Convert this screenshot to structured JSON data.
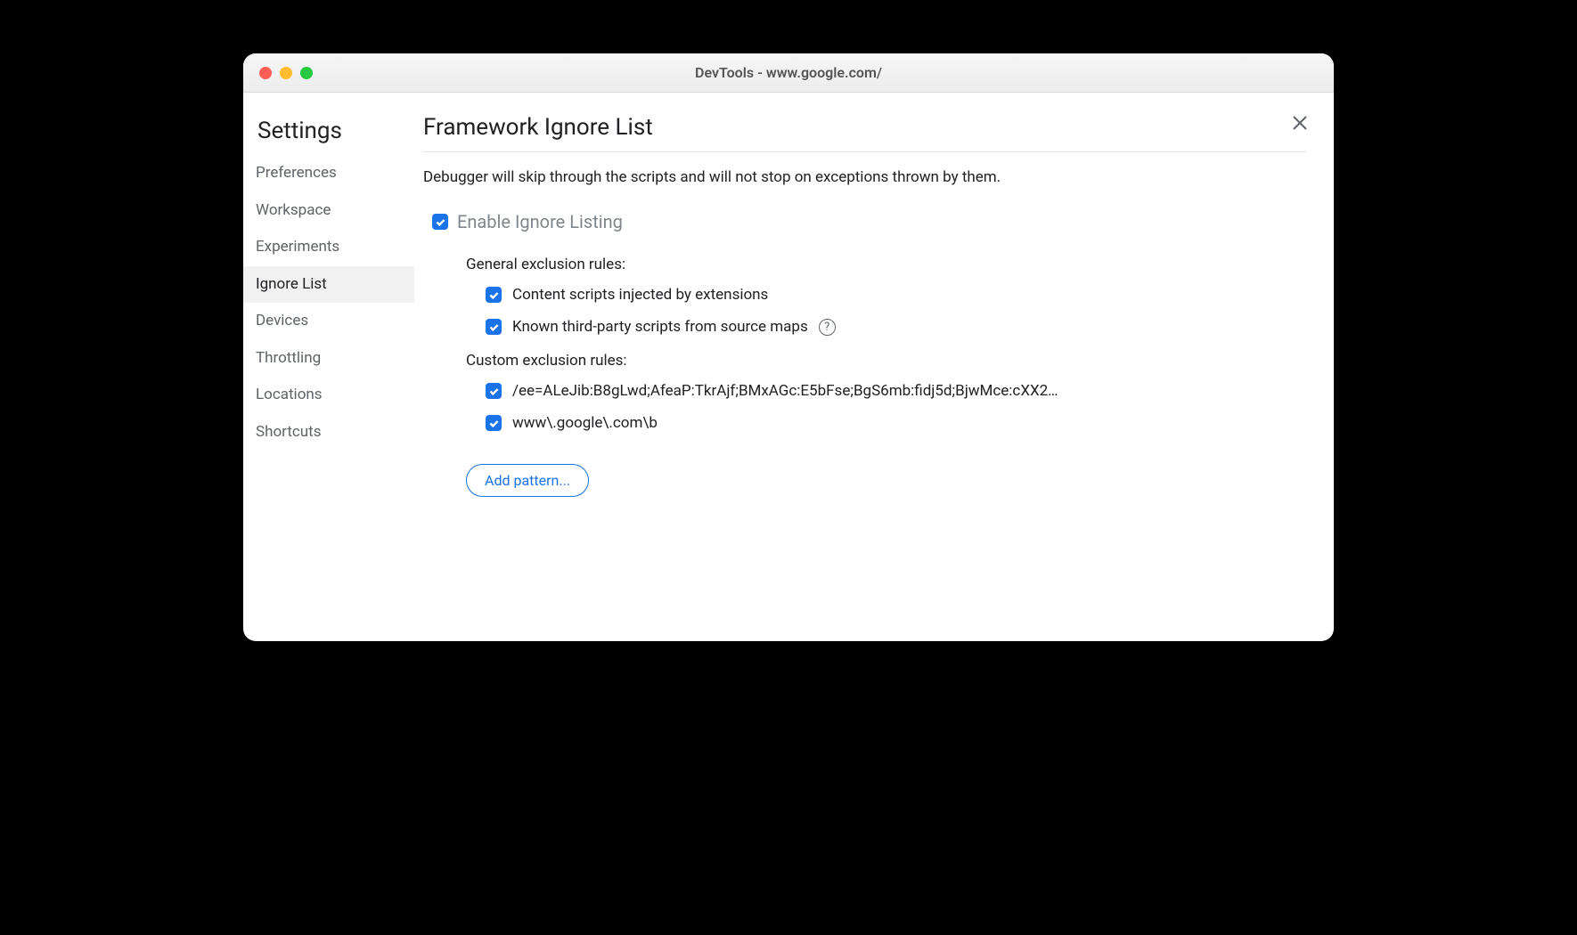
{
  "window": {
    "title": "DevTools - www.google.com/"
  },
  "sidebar": {
    "title": "Settings",
    "items": [
      {
        "label": "Preferences",
        "selected": false
      },
      {
        "label": "Workspace",
        "selected": false
      },
      {
        "label": "Experiments",
        "selected": false
      },
      {
        "label": "Ignore List",
        "selected": true
      },
      {
        "label": "Devices",
        "selected": false
      },
      {
        "label": "Throttling",
        "selected": false
      },
      {
        "label": "Locations",
        "selected": false
      },
      {
        "label": "Shortcuts",
        "selected": false
      }
    ]
  },
  "main": {
    "title": "Framework Ignore List",
    "description": "Debugger will skip through the scripts and will not stop on exceptions thrown by them.",
    "enable": {
      "label": "Enable Ignore Listing",
      "checked": true
    },
    "general_section_title": "General exclusion rules:",
    "general_rules": [
      {
        "label": "Content scripts injected by extensions",
        "checked": true,
        "help": false
      },
      {
        "label": "Known third-party scripts from source maps",
        "checked": true,
        "help": true
      }
    ],
    "custom_section_title": "Custom exclusion rules:",
    "custom_rules": [
      {
        "label": "/ee=ALeJib:B8gLwd;AfeaP:TkrAjf;BMxAGc:E5bFse;BgS6mb:fidj5d;BjwMce:cXX2…",
        "checked": true
      },
      {
        "label": "www\\.google\\.com\\b",
        "checked": true
      }
    ],
    "add_pattern_label": "Add pattern..."
  }
}
